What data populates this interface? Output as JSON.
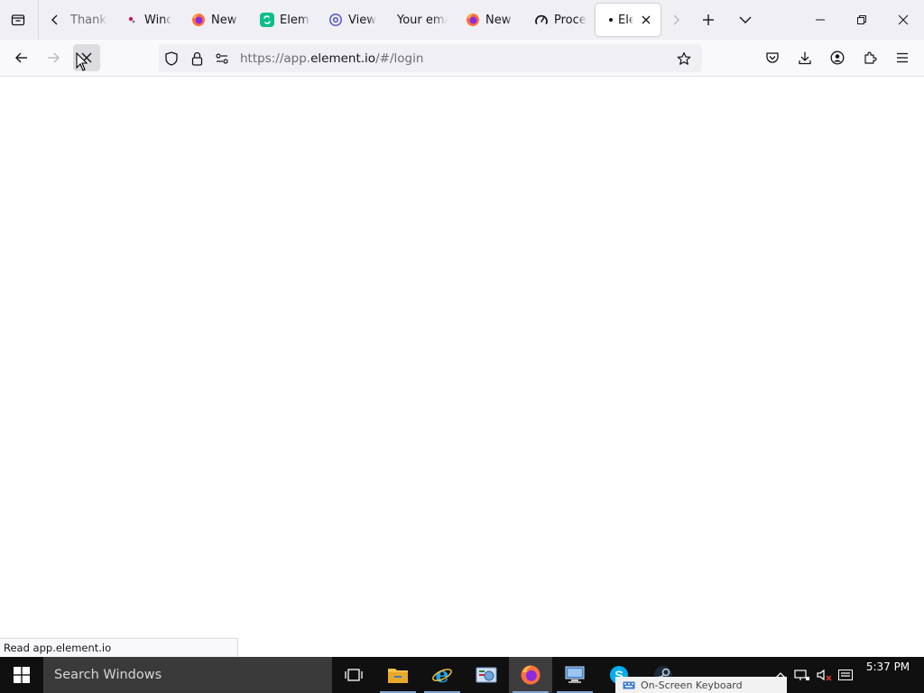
{
  "browser": {
    "tabs": [
      {
        "label": "Thanks",
        "icon": "no-favicon",
        "active": false
      },
      {
        "label": "Windows",
        "icon": "windows-favicon",
        "active": false
      },
      {
        "label": "New Tab",
        "icon": "firefox-icon",
        "active": false
      },
      {
        "label": "Element",
        "icon": "element-icon",
        "active": false
      },
      {
        "label": "View",
        "icon": "at-sign-icon",
        "active": false
      },
      {
        "label": "Your email",
        "icon": "no-favicon",
        "active": false
      },
      {
        "label": "New Tab",
        "icon": "firefox-icon",
        "active": false
      },
      {
        "label": "Process",
        "icon": "gauge-icon",
        "active": false
      },
      {
        "label": "Element",
        "icon": "loading-dot-icon",
        "active": true
      }
    ],
    "url": {
      "prefix": "https://app.",
      "host": "element.io",
      "path": "/#/login"
    },
    "status_text": "Read app.element.io"
  },
  "taskbar": {
    "search_placeholder": "Search Windows",
    "apps": [
      {
        "name": "task-view-icon"
      },
      {
        "name": "file-explorer-icon"
      },
      {
        "name": "internet-explorer-icon"
      },
      {
        "name": "control-panel-icon"
      },
      {
        "name": "firefox-icon",
        "active": true
      },
      {
        "name": "remote-desktop-icon"
      },
      {
        "name": "skype-icon"
      },
      {
        "name": "steam-icon"
      }
    ],
    "osk_label": "On-Screen Keyboard",
    "clock": "5:37 PM"
  },
  "colors": {
    "tabbar_bg": "#f0f0f4",
    "navbar_bg": "#f9f9fb",
    "taskbar_bg": "#101010",
    "accent": "#7aa5d8"
  }
}
